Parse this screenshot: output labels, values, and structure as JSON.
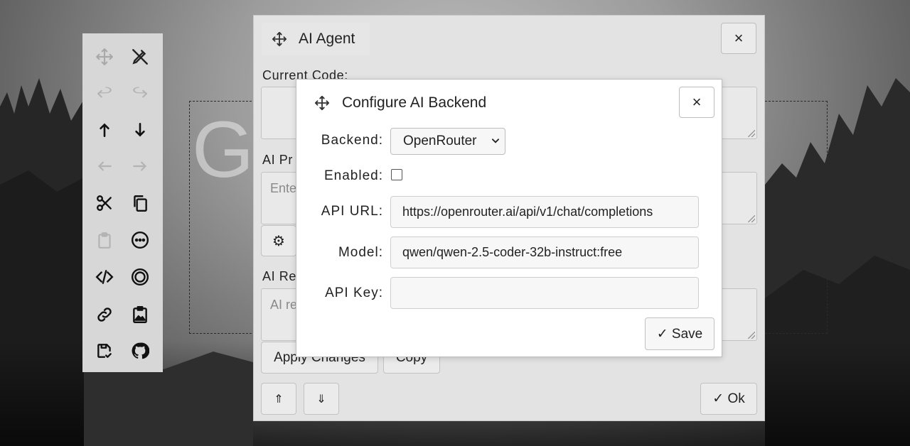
{
  "background": {
    "title_text": "G                    E"
  },
  "toolbar": {
    "tools": [
      {
        "name": "move-icon",
        "enabled": false
      },
      {
        "name": "pen-off-icon",
        "enabled": true
      },
      {
        "name": "undo-icon",
        "enabled": false
      },
      {
        "name": "redo-icon",
        "enabled": false
      },
      {
        "name": "arrow-up-icon",
        "enabled": true
      },
      {
        "name": "arrow-down-icon",
        "enabled": true
      },
      {
        "name": "arrow-left-icon",
        "enabled": false
      },
      {
        "name": "arrow-right-icon",
        "enabled": false
      },
      {
        "name": "scissors-icon",
        "enabled": true
      },
      {
        "name": "copy-icon",
        "enabled": true
      },
      {
        "name": "clipboard-icon",
        "enabled": false
      },
      {
        "name": "more-icon",
        "enabled": true
      },
      {
        "name": "code-icon",
        "enabled": true
      },
      {
        "name": "target-icon",
        "enabled": true
      },
      {
        "name": "link-icon",
        "enabled": true
      },
      {
        "name": "image-icon",
        "enabled": true
      },
      {
        "name": "save-check-icon",
        "enabled": true
      },
      {
        "name": "github-icon",
        "enabled": true
      }
    ]
  },
  "agent": {
    "title": "AI Agent",
    "close_label": "×",
    "current_code_label": "Current Code:",
    "prompt_label": "AI Pr",
    "prompt_placeholder": "Ente",
    "settings_icon": "⚙",
    "response_label": "AI Re",
    "response_placeholder": "AI re",
    "apply_label": "Apply Changes",
    "copy_label": "Copy",
    "up_label": "⇑",
    "down_label": "⇓",
    "ok_label": "✓ Ok"
  },
  "dialog": {
    "title": "Configure AI Backend",
    "close_label": "×",
    "backend_label": "Backend:",
    "backend_value": "OpenRouter",
    "enabled_label": "Enabled:",
    "enabled_checked": false,
    "api_url_label": "API URL:",
    "api_url_value": "https://openrouter.ai/api/v1/chat/completions",
    "model_label": "Model:",
    "model_value": "qwen/qwen-2.5-coder-32b-instruct:free",
    "api_key_label": "API Key:",
    "api_key_value": "",
    "save_label": "✓ Save"
  }
}
